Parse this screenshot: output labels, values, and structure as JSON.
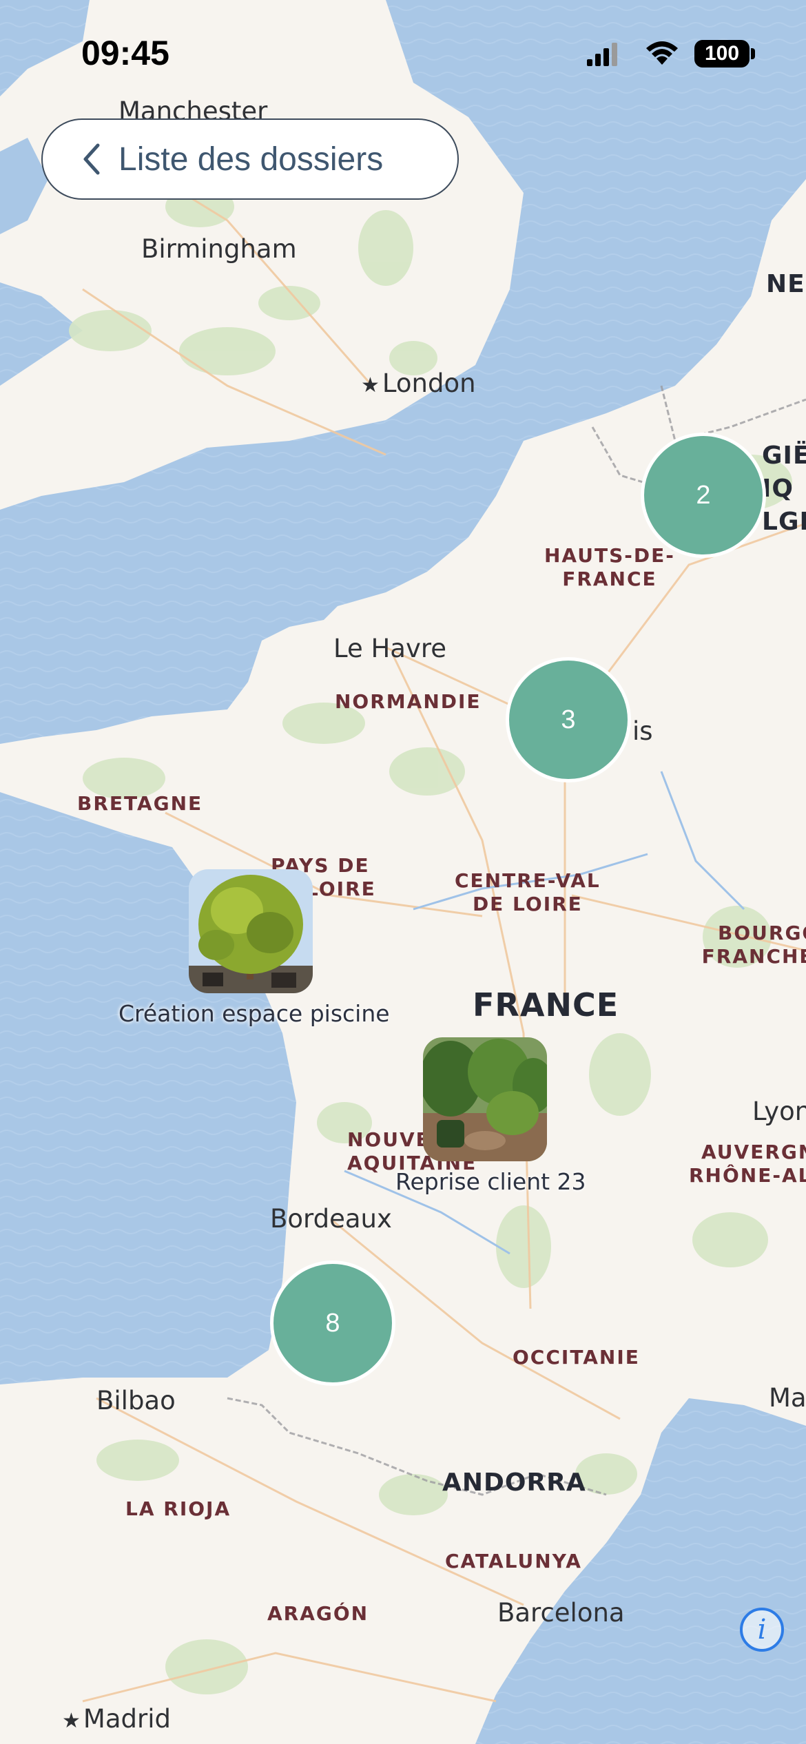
{
  "status_bar": {
    "time": "09:45",
    "battery": "100",
    "signal_icon": "cellular-signal-icon",
    "wifi_icon": "wifi-icon"
  },
  "back_button": {
    "label": "Liste des dossiers",
    "icon": "chevron-left-icon"
  },
  "map": {
    "cities": {
      "manchester": "Manchester",
      "birmingham": "Birmingham",
      "london": "London",
      "le_havre": "Le Havre",
      "paris_fragment": "is",
      "bordeaux": "Bordeaux",
      "bilbao": "Bilbao",
      "barcelona": "Barcelona",
      "madrid": "Madrid",
      "lyon": "Lyon",
      "marseille_fragment": "Ma"
    },
    "regions": {
      "hauts_de_france": [
        "HAUTS-DE-",
        "FRANCE"
      ],
      "normandie": "NORMANDIE",
      "bretagne": "BRETAGNE",
      "pays_de_loire": [
        "PAYS DE",
        "LOIRE"
      ],
      "centre_val_de_loire": [
        "CENTRE-VAL",
        "DE LOIRE"
      ],
      "bourgogne": [
        "BOURGO",
        "FRANCHE"
      ],
      "nouvelle_aquitaine": [
        "NOUVE",
        "AQUITAINE"
      ],
      "auvergne": [
        "AUVERGN",
        "RHÔNE-AL"
      ],
      "occitanie": "OCCITANIE",
      "la_rioja": "LA RIOJA",
      "aragon": "ARAGÓN",
      "catalunya": "CATALUNYA"
    },
    "countries": {
      "france": "FRANCE",
      "andorra": "ANDORRA",
      "netherlands_fragment": "NE",
      "belgium_fragment": [
        "GIË",
        "IQ",
        "LGI"
      ]
    },
    "clusters": {
      "north_east": "2",
      "paris": "3",
      "south_west": "8"
    },
    "pins": {
      "pool": {
        "caption": "Création espace piscine"
      },
      "client": {
        "caption": "Reprise client 23"
      }
    },
    "colors": {
      "water": "#a9c7e6",
      "land": "#f7f4ef",
      "cluster": "#68b09a",
      "info": "#2d7ce6"
    }
  },
  "info_button": {
    "label": "i"
  }
}
